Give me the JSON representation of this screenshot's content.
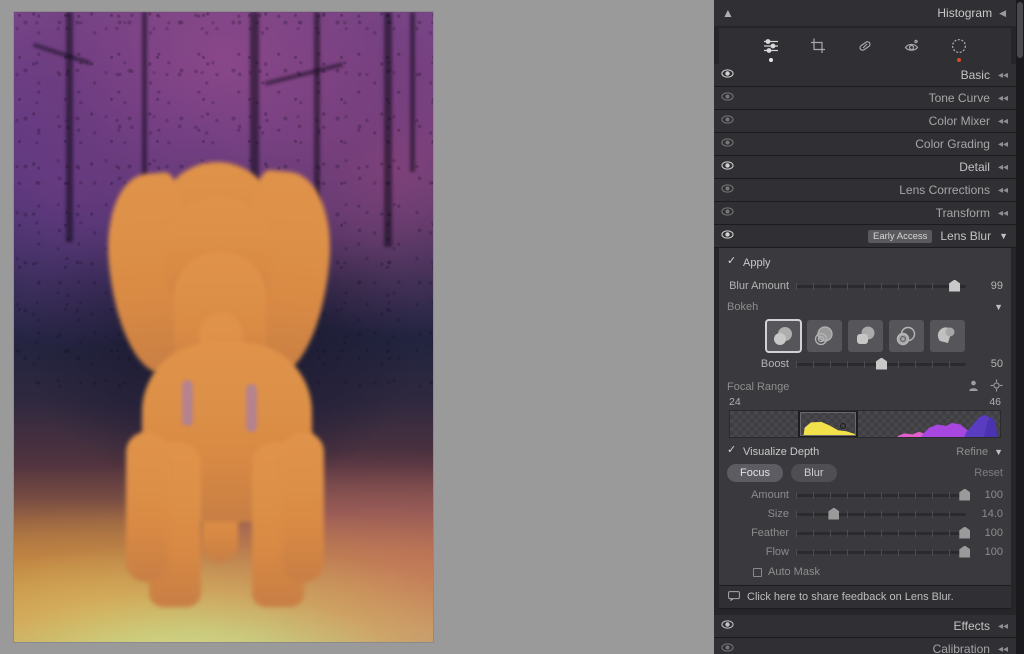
{
  "app": {
    "canvas_bg": "#9a9a9a",
    "panel_bg": "#26262a"
  },
  "histogram": {
    "title": "Histogram",
    "warning_icon": "warning-triangle-icon",
    "collapse_icon": "triangle-left-icon"
  },
  "toolstrip": {
    "tools": [
      {
        "name": "edit-sliders-icon",
        "active": true,
        "dot": "white"
      },
      {
        "name": "crop-icon",
        "active": false,
        "dot": "none"
      },
      {
        "name": "healing-brush-icon",
        "active": false,
        "dot": "none"
      },
      {
        "name": "red-eye-icon",
        "active": false,
        "dot": "none"
      },
      {
        "name": "masking-icon",
        "active": false,
        "dot": "red"
      }
    ]
  },
  "panels": [
    {
      "label": "Basic",
      "eye": "on",
      "chevron": "collapse"
    },
    {
      "label": "Tone Curve",
      "eye": "off",
      "chevron": "collapse"
    },
    {
      "label": "Color Mixer",
      "eye": "off",
      "chevron": "collapse"
    },
    {
      "label": "Color Grading",
      "eye": "off",
      "chevron": "collapse"
    },
    {
      "label": "Detail",
      "eye": "on",
      "chevron": "collapse"
    },
    {
      "label": "Lens Corrections",
      "eye": "off",
      "chevron": "collapse"
    },
    {
      "label": "Transform",
      "eye": "off",
      "chevron": "collapse"
    }
  ],
  "lens_blur": {
    "header_label": "Lens Blur",
    "badge": "Early Access",
    "eye": "on",
    "expand_icon": "triangle-down-icon",
    "apply": {
      "label": "Apply",
      "checked": true
    },
    "blur_amount": {
      "label": "Blur Amount",
      "value": "99",
      "percent": 93
    },
    "bokeh": {
      "label": "Bokeh",
      "expand_icon": "triangle-down-icon",
      "shapes": [
        {
          "name": "bokeh-circle",
          "selected": true
        },
        {
          "name": "bokeh-bubble",
          "selected": false
        },
        {
          "name": "bokeh-ring-5blade",
          "selected": false
        },
        {
          "name": "bokeh-ring-soap",
          "selected": false
        },
        {
          "name": "bokeh-swirl",
          "selected": false
        }
      ]
    },
    "boost": {
      "label": "Boost",
      "value": "50",
      "percent": 50
    },
    "focal_range": {
      "label": "Focal Range",
      "subject_icon": "subject-person-icon",
      "picker_icon": "crosshair-target-icon",
      "min": "24",
      "max": "46"
    },
    "visualize_depth": {
      "label": "Visualize Depth",
      "checked": true
    },
    "refine": {
      "label": "Refine",
      "expand_icon": "triangle-down-icon"
    },
    "brush_modes": {
      "focus": "Focus",
      "blur": "Blur",
      "reset": "Reset"
    },
    "brush_sliders": [
      {
        "label": "Amount",
        "value": "100",
        "percent": 100
      },
      {
        "label": "Size",
        "value": "14.0",
        "percent": 22
      },
      {
        "label": "Feather",
        "value": "100",
        "percent": 100
      },
      {
        "label": "Flow",
        "value": "100",
        "percent": 100
      }
    ],
    "auto_mask": {
      "label": "Auto Mask",
      "checked": false
    },
    "feedback": {
      "text": "Click here to share feedback on Lens Blur.",
      "icon": "speech-bubble-icon"
    }
  },
  "panels_bottom": [
    {
      "label": "Effects",
      "eye": "on",
      "chevron": "collapse"
    },
    {
      "label": "Calibration",
      "eye": "off",
      "chevron": "collapse"
    }
  ],
  "photo": {
    "name": "elephant-depth-visualization",
    "description": "Elephant depth map visualization"
  }
}
